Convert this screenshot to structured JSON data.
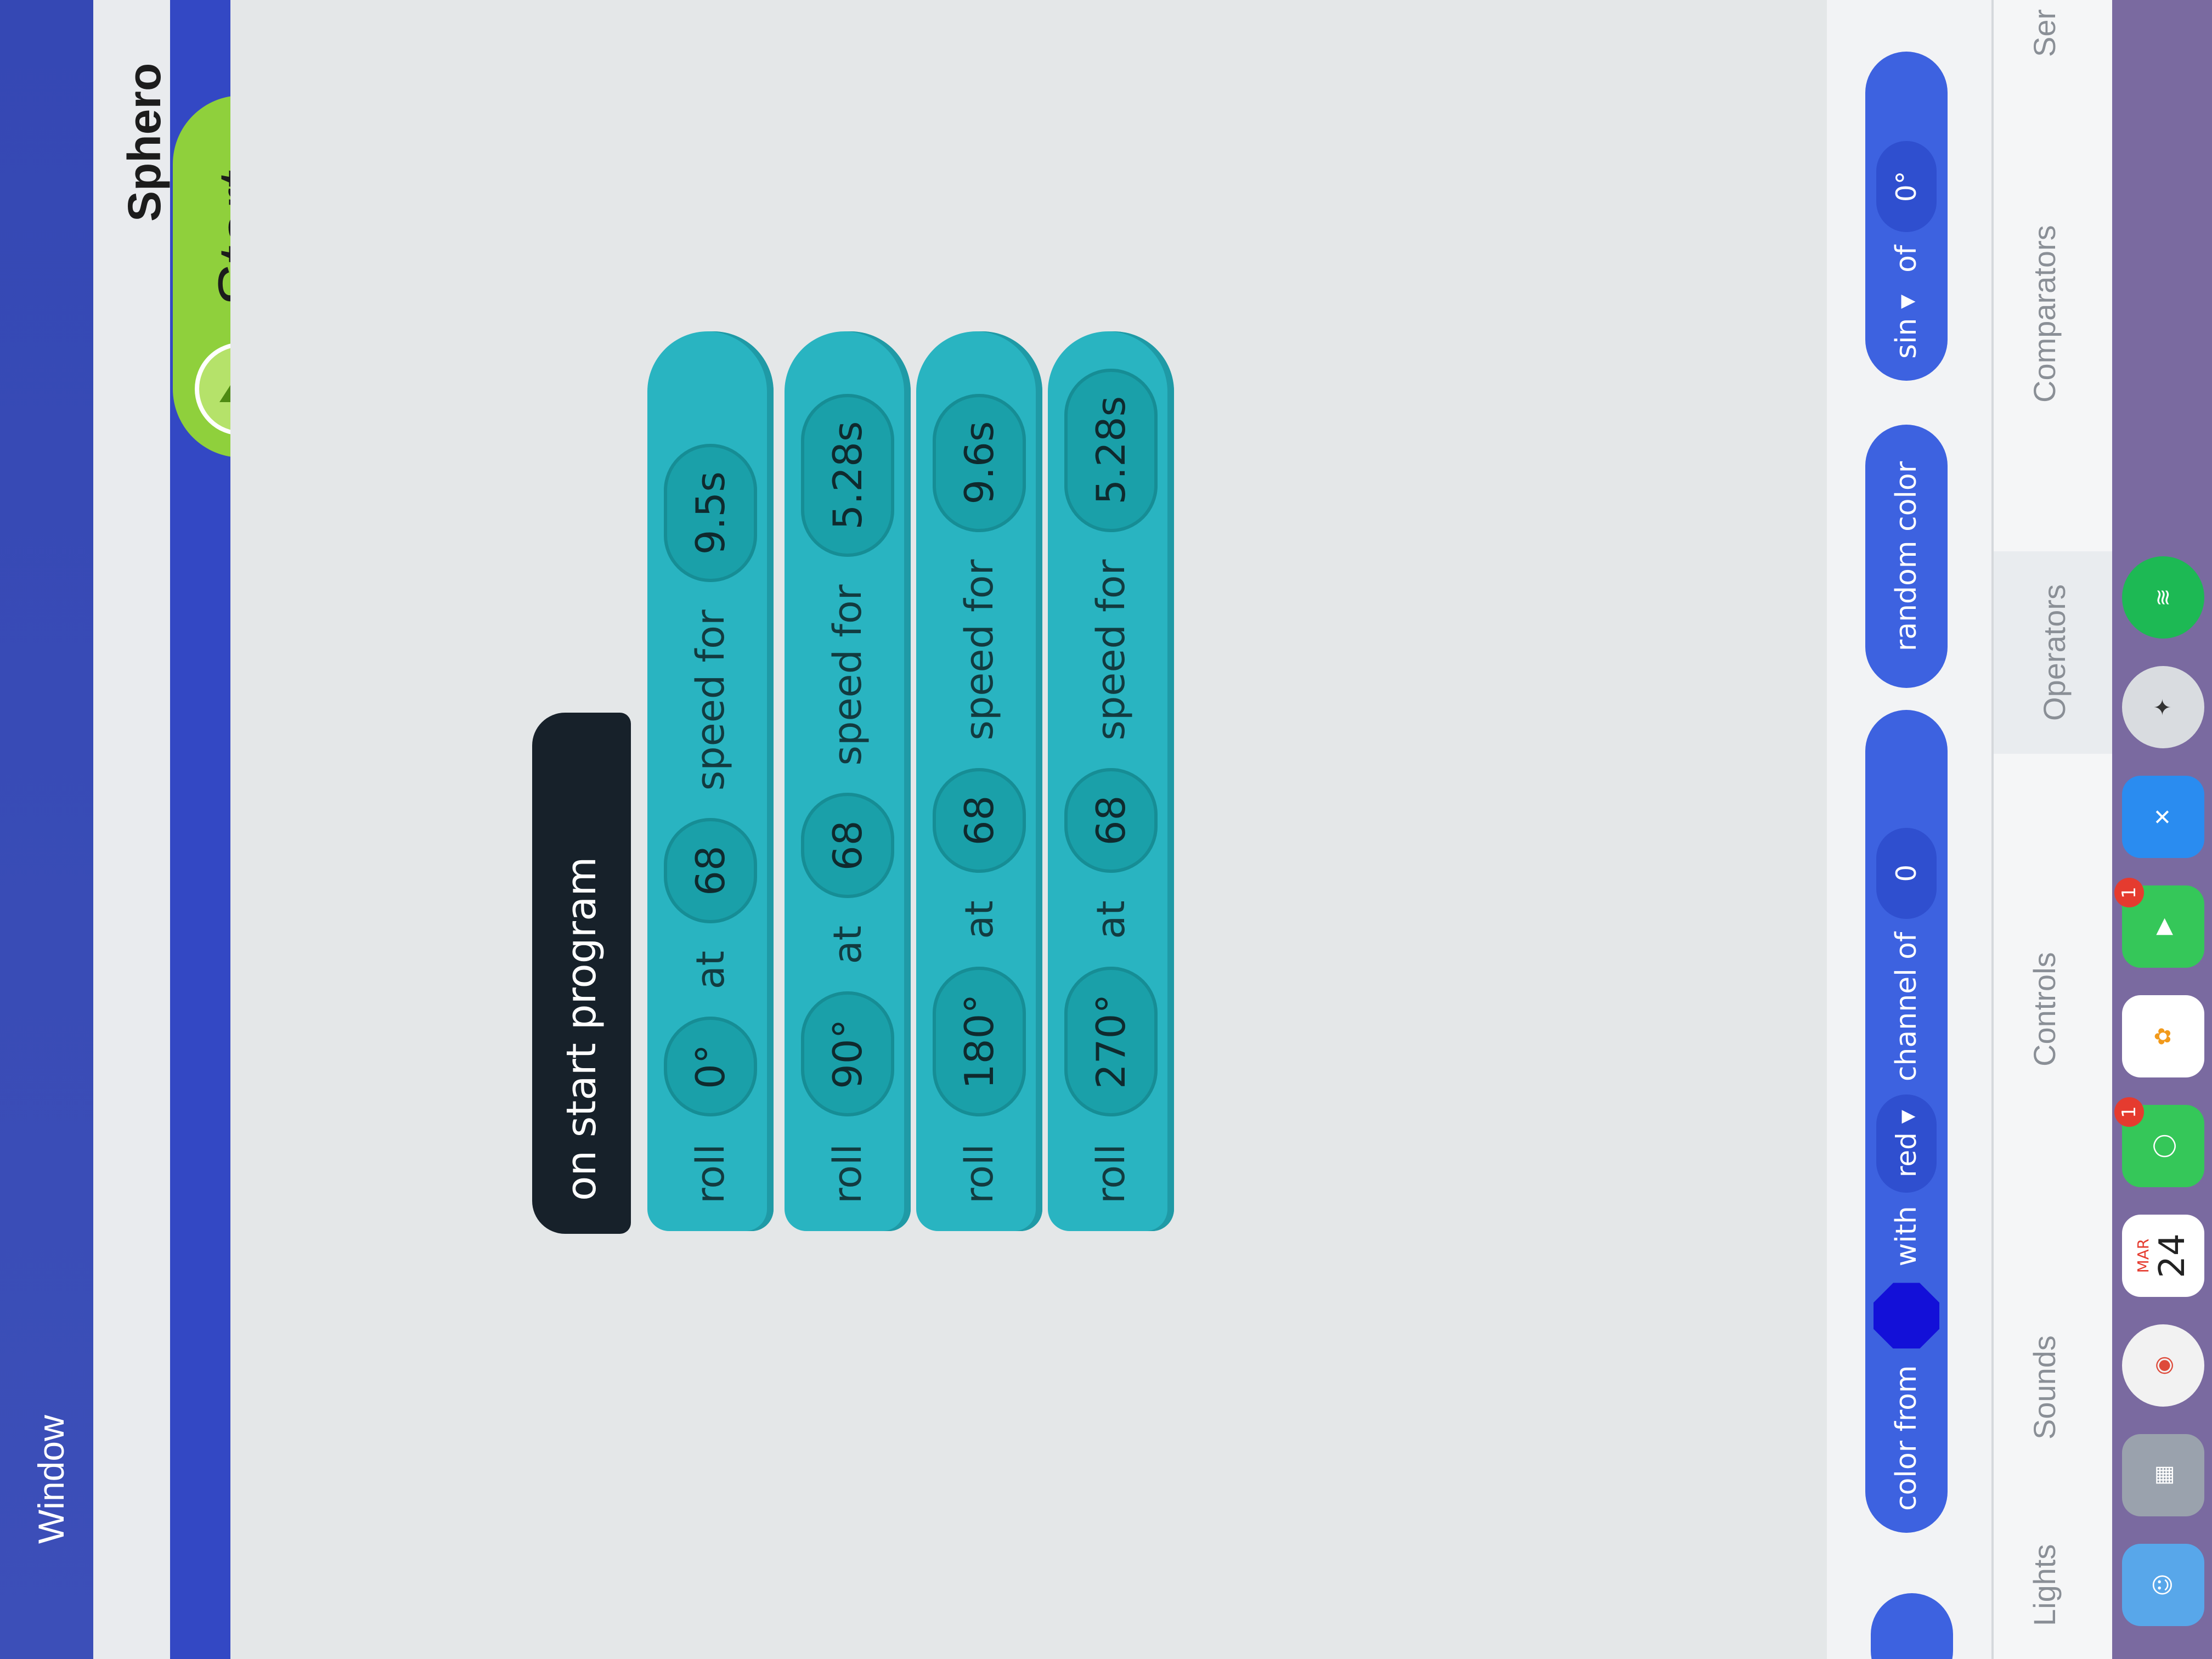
{
  "menubar": {
    "window_menu": "Window"
  },
  "app": {
    "title": "Sphero Edu"
  },
  "toolbar": {
    "start_label": "Start"
  },
  "program": {
    "event_label": "on start program",
    "blocks": [
      {
        "command": "roll",
        "heading": "0°",
        "at": "at",
        "speed": "68",
        "speed_for": "speed for",
        "duration": "9.5s"
      },
      {
        "command": "roll",
        "heading": "90°",
        "at": "at",
        "speed": "68",
        "speed_for": "speed for",
        "duration": "5.28s"
      },
      {
        "command": "roll",
        "heading": "180°",
        "at": "at",
        "speed": "68",
        "speed_for": "speed for",
        "duration": "9.6s"
      },
      {
        "command": "roll",
        "heading": "270°",
        "at": "at",
        "speed": "68",
        "speed_for": "speed for",
        "duration": "5.28s"
      }
    ]
  },
  "palette": {
    "color_from": "color from",
    "with": "with",
    "channel_select": "red ▾",
    "channel_of": "channel of",
    "channel_value": "0",
    "random_color": "random color",
    "trig_select": "sin ▾",
    "of": "of",
    "trig_value": "0°"
  },
  "tabs": {
    "lights": "Lights",
    "sounds": "Sounds",
    "controls": "Controls",
    "operators": "Operators",
    "comparators": "Comparators",
    "sensors": "Ser"
  },
  "dock": {
    "calendar_month": "MAR",
    "calendar_day": "24",
    "badge_messages": "1",
    "badge_facetime": "1"
  },
  "colors": {
    "block_teal": "#29b4c1",
    "start_green": "#8fd03c",
    "title_bar_blue": "#3348c4",
    "palette_blue": "#3d62e0"
  }
}
